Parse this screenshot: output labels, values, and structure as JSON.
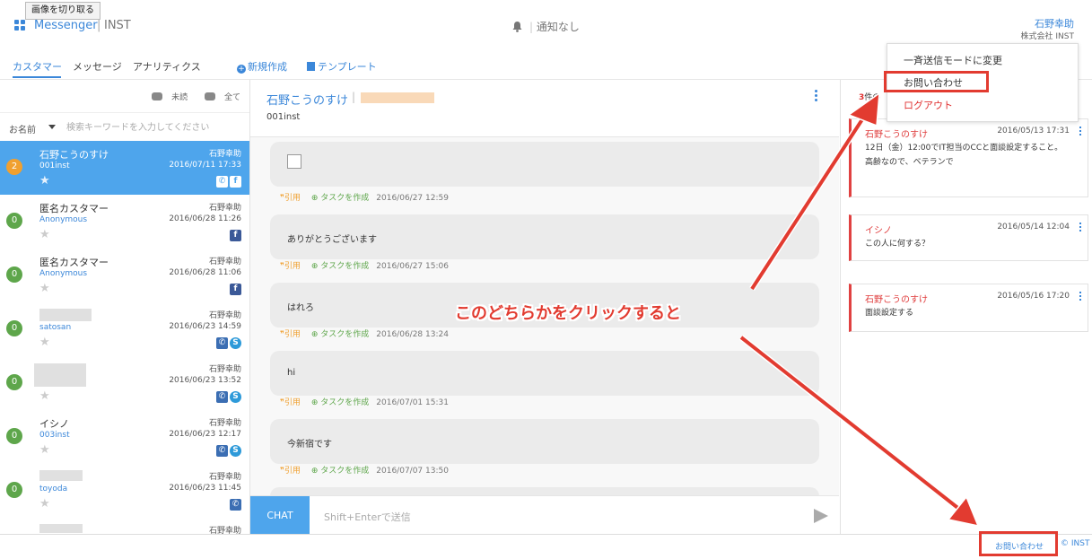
{
  "tooltip": "画像を切り取る",
  "header": {
    "app_name": "Messenger",
    "org": "INST",
    "notification": "通知なし",
    "user_name": "石野幸助",
    "company": "株式会社 INST"
  },
  "nav": {
    "tabs": [
      "カスタマー",
      "メッセージ",
      "アナリティクス"
    ],
    "new_label": "新規作成",
    "template_label": "テンプレート"
  },
  "filters": {
    "unread": "未読",
    "all": "全て"
  },
  "search": {
    "sort_label": "お名前",
    "placeholder": "検索キーワードを入力してください"
  },
  "customers": [
    {
      "badge": "2",
      "name": "石野こうのすけ",
      "sub": "001inst",
      "agent": "石野幸助",
      "date": "2016/07/11 17:33",
      "channels": [
        "phone",
        "facebook"
      ]
    },
    {
      "badge": "0",
      "name": "匿名カスタマー",
      "sub": "Anonymous",
      "agent": "石野幸助",
      "date": "2016/06/28 11:26",
      "channels": [
        "facebook"
      ]
    },
    {
      "badge": "0",
      "name": "匿名カスタマー",
      "sub": "Anonymous",
      "agent": "石野幸助",
      "date": "2016/06/28 11:06",
      "channels": [
        "facebook"
      ]
    },
    {
      "badge": "0",
      "name": "",
      "sub": "satosan",
      "agent": "石野幸助",
      "date": "2016/06/23 14:59",
      "channels": [
        "phone",
        "skype"
      ]
    },
    {
      "badge": "0",
      "name": "",
      "sub": "",
      "agent": "石野幸助",
      "date": "2016/06/23 13:52",
      "channels": [
        "phone",
        "skype"
      ]
    },
    {
      "badge": "0",
      "name": "イシノ",
      "sub": "003inst",
      "agent": "石野幸助",
      "date": "2016/06/23 12:17",
      "channels": [
        "phone",
        "skype"
      ]
    },
    {
      "badge": "0",
      "name": "",
      "sub": "toyoda",
      "agent": "石野幸助",
      "date": "2016/06/23 11:45",
      "channels": [
        "phone"
      ]
    },
    {
      "badge": "",
      "name": "",
      "sub": "",
      "agent": "石野幸助",
      "date": "",
      "channels": []
    }
  ],
  "conversation": {
    "name": "石野こうのすけ",
    "id": "001inst",
    "quote_label": "引用",
    "task_label": "タスクを作成",
    "messages": [
      {
        "text": "",
        "image": true,
        "date": "2016/06/27 12:59"
      },
      {
        "text": "ありがとうございます",
        "date": "2016/06/27 15:06"
      },
      {
        "text": "はれろ",
        "date": "2016/06/28 13:24"
      },
      {
        "text": "hi",
        "date": "2016/07/01 15:31"
      },
      {
        "text": "今新宿です",
        "date": "2016/07/07 13:50"
      }
    ],
    "chat_button": "CHAT",
    "chat_placeholder": "Shift+Enterで送信"
  },
  "tasks": {
    "count": "3",
    "count_suffix": "件の",
    "items": [
      {
        "who": "石野こうのすけ",
        "date": "2016/05/13 17:31",
        "body": "12日（金）12:00でIT担当のCCと面談設定すること。\n高齢なので、ベテランで"
      },
      {
        "who": "イシノ",
        "date": "2016/05/14 12:04",
        "body": "この人に何する？"
      },
      {
        "who": "石野こうのすけ",
        "date": "2016/05/16 17:20",
        "body": "面談設定する"
      }
    ]
  },
  "dropdown": {
    "bulk_mode": "一斉送信モードに変更",
    "contact": "お問い合わせ",
    "logout": "ログアウト"
  },
  "footer": {
    "contact": "お問い合わせ",
    "brand": "INST"
  },
  "annotation": "このどちらかをクリックすると",
  "colors": {
    "accent": "#3b87d9",
    "annotation": "#e23b30",
    "selected": "#4ea5ec"
  }
}
